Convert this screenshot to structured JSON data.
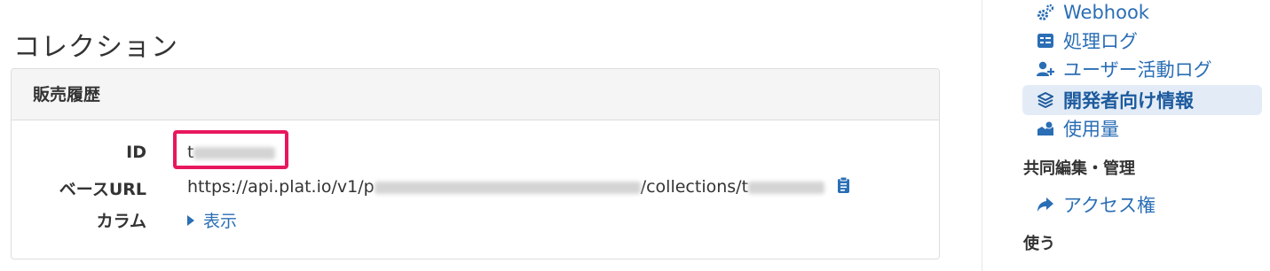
{
  "page": {
    "title": "コレクション"
  },
  "panel": {
    "title": "販売履歴",
    "rows": {
      "id": {
        "label": "ID",
        "value_prefix": "t"
      },
      "base_url": {
        "label": "ベースURL",
        "value_prefix": "https://api.plat.io/v1/p",
        "value_mid": "/collections/t"
      },
      "columns": {
        "label": "カラム",
        "toggle_label": "表示"
      }
    }
  },
  "sidebar": {
    "items": [
      {
        "label": "Webhook",
        "icon": "gears-icon",
        "active": false
      },
      {
        "label": "処理ログ",
        "icon": "list-card-icon",
        "active": false
      },
      {
        "label": "ユーザー活動ログ",
        "icon": "user-plus-icon",
        "active": false
      },
      {
        "label": "開発者向け情報",
        "icon": "layers-icon",
        "active": true
      },
      {
        "label": "使用量",
        "icon": "usage-icon",
        "active": false
      }
    ],
    "section_collab": "共同編集・管理",
    "access_label": "アクセス権",
    "section_use": "使う"
  },
  "colors": {
    "link": "#2a6eb5",
    "highlight_border": "#e8175d",
    "active_bg": "#e3ecf6"
  }
}
